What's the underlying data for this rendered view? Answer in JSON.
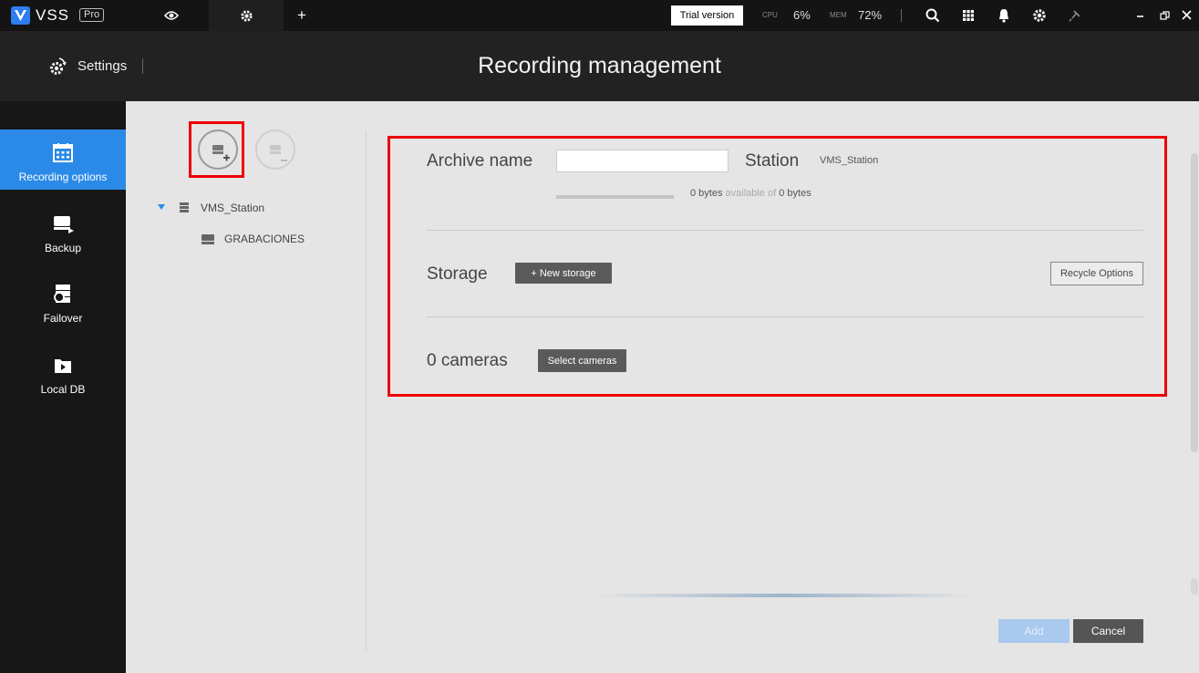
{
  "app": {
    "logo_text": "VSS",
    "edition": "Pro"
  },
  "topbar": {
    "trial_label": "Trial version",
    "cpu_label": "CPU",
    "cpu_value": "6%",
    "mem_label": "MEM",
    "mem_value": "72%",
    "new_tab": "+"
  },
  "header": {
    "section": "Settings",
    "title": "Recording management"
  },
  "sidebar": {
    "items": [
      {
        "label": "Recording options",
        "icon": "calendar-icon"
      },
      {
        "label": "Backup",
        "icon": "backup-icon"
      },
      {
        "label": "Failover",
        "icon": "failover-icon"
      },
      {
        "label": "Local DB",
        "icon": "local-db-icon"
      }
    ]
  },
  "tree": {
    "station": "VMS_Station",
    "archive": "GRABACIONES"
  },
  "form": {
    "archive_name_label": "Archive name",
    "archive_name_value": "",
    "station_label": "Station",
    "station_value": "VMS_Station",
    "storage_used": "0 bytes",
    "storage_mid": "available of",
    "storage_total": "0 bytes",
    "storage_fill": 0,
    "storage_label": "Storage",
    "new_storage_label": "+ New storage",
    "recycle_label": "Recycle Options",
    "cameras_label": "0 cameras",
    "select_cameras_label": "Select cameras",
    "add_label": "Add",
    "cancel_label": "Cancel"
  },
  "colors": {
    "accent": "#2b8ae8",
    "highlight": "#e00000"
  }
}
